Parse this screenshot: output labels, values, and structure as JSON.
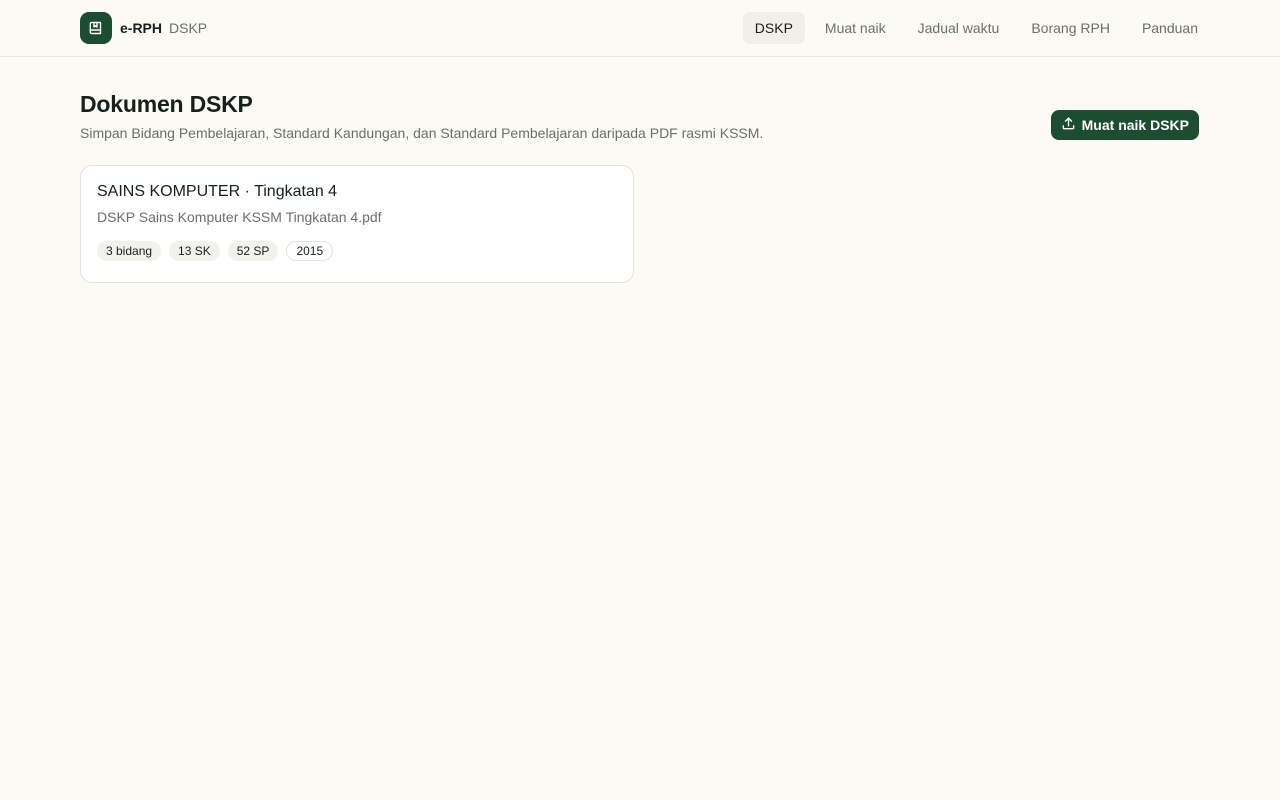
{
  "app": {
    "name": "e-RPH",
    "section": "DSKP"
  },
  "nav": {
    "items": [
      {
        "label": "DSKP",
        "active": true
      },
      {
        "label": "Muat naik",
        "active": false
      },
      {
        "label": "Jadual waktu",
        "active": false
      },
      {
        "label": "Borang RPH",
        "active": false
      },
      {
        "label": "Panduan",
        "active": false
      }
    ]
  },
  "page": {
    "title": "Dokumen DSKP",
    "description": "Simpan Bidang Pembelajaran, Standard Kandungan, dan Standard Pembelajaran daripada PDF rasmi KSSM.",
    "upload_label": "Muat naik DSKP"
  },
  "documents": [
    {
      "title": "SAINS KOMPUTER · Tingkatan 4",
      "file": "DSKP Sains Komputer KSSM Tingkatan 4.pdf",
      "chips": [
        "3 bidang",
        "13 SK",
        "52 SP",
        "2015"
      ]
    }
  ],
  "colors": {
    "brand": "#1d4d31",
    "background": "#fcfaf5"
  },
  "icons": {
    "logo": "book-icon",
    "upload": "upload-icon"
  }
}
